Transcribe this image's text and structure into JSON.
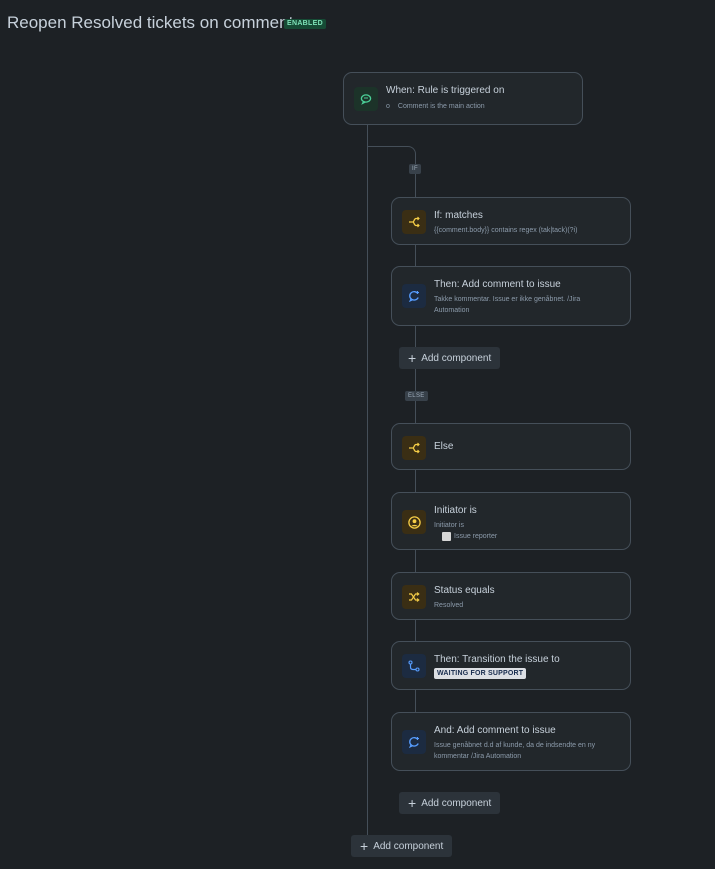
{
  "header": {
    "title": "Reopen Resolved tickets on comment",
    "status": "ENABLED"
  },
  "trigger": {
    "title": "When: Rule is triggered on",
    "subtitle": "Comment is the main action",
    "bullet": "o",
    "icon": "comment-trigger-icon"
  },
  "branches": {
    "if_label": "IF",
    "else_label": "ELSE"
  },
  "if_condition": {
    "title": "If: matches",
    "subtitle": "{{comment.body}} contains regex (tak|tack)(?i)",
    "icon": "branch-icon"
  },
  "then_comment": {
    "title": "Then: Add comment to issue",
    "subtitle": "Takke kommentar. Issue er ikke genåbnet. /Jira Automation",
    "icon": "comment-action-icon"
  },
  "else_block": {
    "title": "Else",
    "icon": "branch-icon"
  },
  "initiator": {
    "title": "Initiator is",
    "subtitle": "Initiator is",
    "value": "Issue reporter",
    "icon": "user-icon"
  },
  "status_equals": {
    "title": "Status equals",
    "subtitle": "Resolved",
    "icon": "shuffle-icon"
  },
  "transition": {
    "title": "Then: Transition the issue to",
    "status": "WAITING FOR SUPPORT",
    "icon": "transition-icon"
  },
  "and_comment": {
    "title": "And: Add comment to issue",
    "subtitle": "Issue genåbnet d.d af kunde, da de indsendte en ny kommentar /Jira Automation",
    "icon": "comment-action-icon"
  },
  "add_component_label": "Add component",
  "colors": {
    "background": "#1d2125",
    "card": "#22272b",
    "border": "#454f59",
    "green": "#4bce97",
    "yellow": "#f5cd47",
    "blue": "#579dff"
  }
}
